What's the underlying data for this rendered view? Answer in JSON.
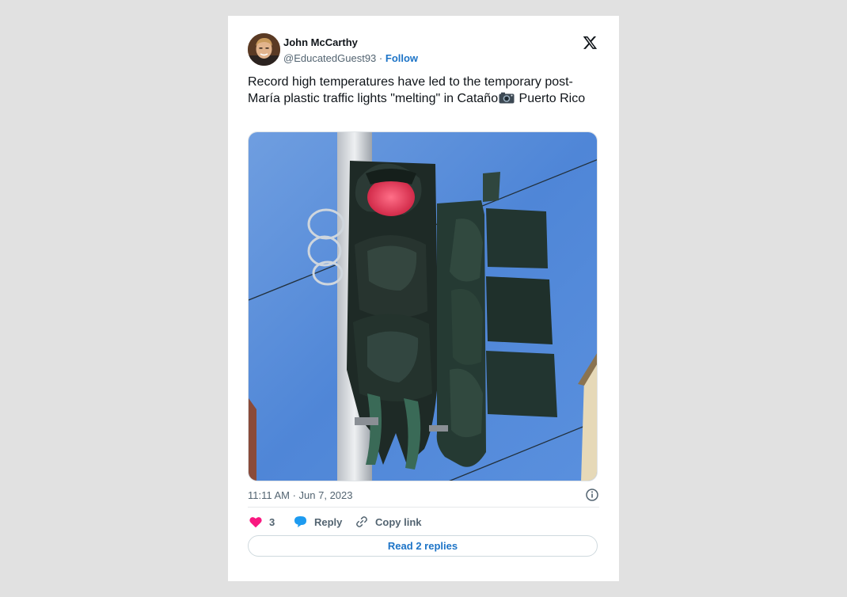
{
  "author": {
    "name": "John McCarthy",
    "handle": "@EducatedGuest93",
    "separator": "·",
    "follow_label": "Follow"
  },
  "tweet": {
    "text_before_emoji": "Record high temperatures have led to the temporary post-María plastic traffic lights \"melting\" in Cataño",
    "emoji": "camera-icon",
    "text_after_emoji": " Puerto Rico",
    "timestamp": "11:11 AM · Jun 7, 2023"
  },
  "actions": {
    "like_count": "3",
    "reply_label": "Reply",
    "copy_link_label": "Copy link",
    "read_replies_label": "Read 2 replies"
  },
  "colors": {
    "background": "#e1e1e1",
    "card": "#ffffff",
    "link_blue": "#1d74c7",
    "heart_pink": "#f91880",
    "reply_blue": "#1d9bf0",
    "muted_text": "#536471"
  },
  "icons": {
    "brand": "x-logo-icon",
    "info": "info-icon",
    "like": "heart-icon",
    "reply": "speech-bubble-icon",
    "copy": "link-icon"
  }
}
